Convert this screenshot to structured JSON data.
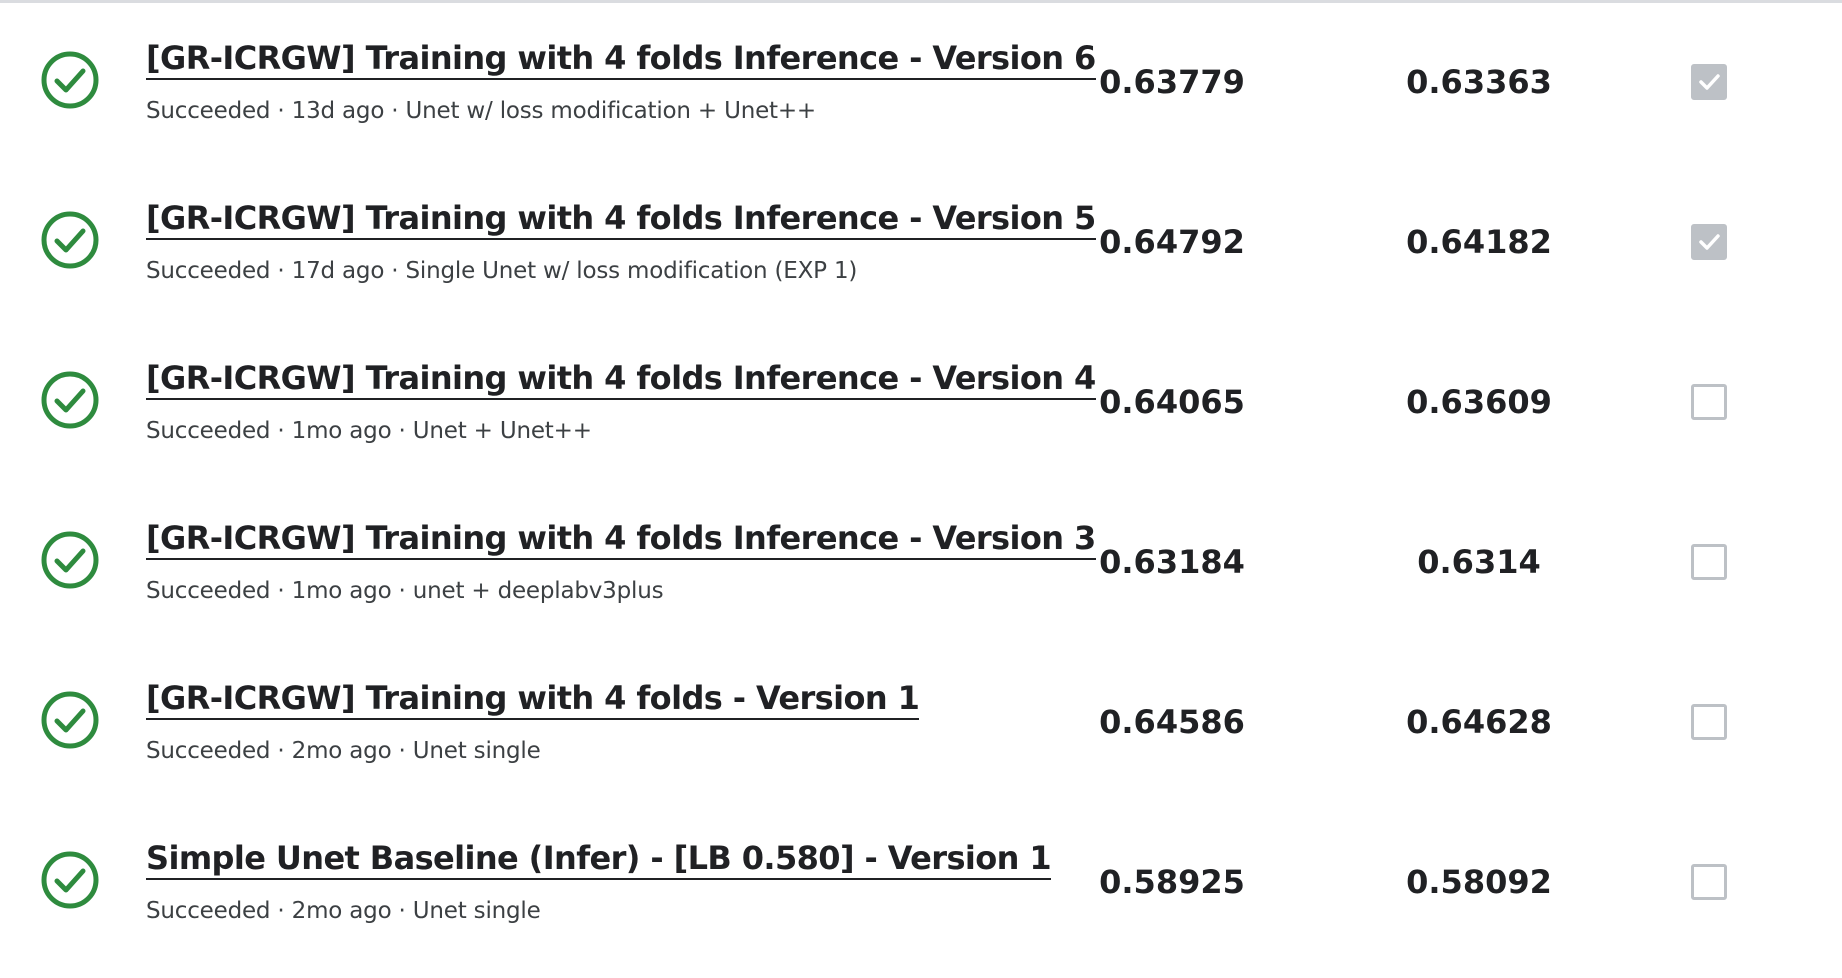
{
  "colors": {
    "success": "#2e8b3e",
    "text": "#202124",
    "checkbox_border": "#bdc1c6"
  },
  "submissions": [
    {
      "status_icon": "check-circle-icon",
      "title": "[GR-ICRGW] Training with 4 folds Inference - Version 6",
      "subtitle": "Succeeded · 13d ago · Unet w/ loss modification + Unet++",
      "private_score": "0.63779",
      "public_score": "0.63363",
      "selected": true
    },
    {
      "status_icon": "check-circle-icon",
      "title": "[GR-ICRGW] Training with 4 folds Inference - Version 5",
      "subtitle": "Succeeded · 17d ago · Single Unet w/ loss modification (EXP 1)",
      "private_score": "0.64792",
      "public_score": "0.64182",
      "selected": true
    },
    {
      "status_icon": "check-circle-icon",
      "title": "[GR-ICRGW] Training with 4 folds Inference - Version 4",
      "subtitle": "Succeeded · 1mo ago · Unet + Unet++",
      "private_score": "0.64065",
      "public_score": "0.63609",
      "selected": false
    },
    {
      "status_icon": "check-circle-icon",
      "title": "[GR-ICRGW] Training with 4 folds Inference - Version 3",
      "subtitle": "Succeeded · 1mo ago · unet + deeplabv3plus",
      "private_score": "0.63184",
      "public_score": "0.6314",
      "selected": false
    },
    {
      "status_icon": "check-circle-icon",
      "title": "[GR-ICRGW] Training with 4 folds - Version 1",
      "subtitle": "Succeeded · 2mo ago · Unet single",
      "private_score": "0.64586",
      "public_score": "0.64628",
      "selected": false
    },
    {
      "status_icon": "check-circle-icon",
      "title": "Simple Unet Baseline (Infer) - [LB 0.580] - Version 1",
      "subtitle": "Succeeded · 2mo ago · Unet single",
      "private_score": "0.58925",
      "public_score": "0.58092",
      "selected": false
    }
  ]
}
